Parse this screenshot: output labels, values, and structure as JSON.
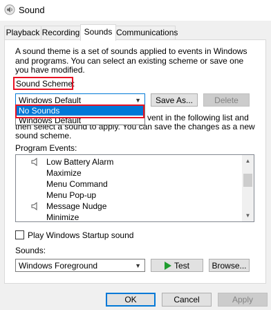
{
  "window": {
    "title": "Sound",
    "icon": "speaker-icon"
  },
  "tabs": [
    {
      "label": "Playback"
    },
    {
      "label": "Recording"
    },
    {
      "label": "Sounds"
    },
    {
      "label": "Communications"
    }
  ],
  "active_tab": "Sounds",
  "description": "A sound theme is a set of sounds applied to events in Windows and programs.  You can select an existing scheme or save one you have modified.",
  "sound_scheme": {
    "label": "Sound Scheme:",
    "value": "Windows Default",
    "save_as_label": "Save As...",
    "delete_label": "Delete",
    "options": [
      "No Sounds",
      "Windows Default"
    ],
    "highlighted_option": "No Sounds"
  },
  "change_text": {
    "right_line": "vent in the following list and",
    "second_line": "then select a sound to apply.  You can save the changes as a new",
    "third_line": "sound scheme."
  },
  "program_events": {
    "label": "Program Events:",
    "items": [
      {
        "label": "Low Battery Alarm",
        "has_sound": true
      },
      {
        "label": "Maximize",
        "has_sound": false
      },
      {
        "label": "Menu Command",
        "has_sound": false
      },
      {
        "label": "Menu Pop-up",
        "has_sound": false
      },
      {
        "label": "Message Nudge",
        "has_sound": true
      },
      {
        "label": "Minimize",
        "has_sound": false
      }
    ]
  },
  "startup": {
    "label": "Play Windows Startup sound",
    "checked": false
  },
  "sounds": {
    "label": "Sounds:",
    "value": "Windows Foreground",
    "test_label": "Test",
    "browse_label": "Browse..."
  },
  "footer": {
    "ok_label": "OK",
    "cancel_label": "Cancel",
    "apply_label": "Apply"
  },
  "colors": {
    "highlight_red": "#e81123",
    "selection_blue": "#0078d7",
    "play_green": "#1e9c2e"
  }
}
